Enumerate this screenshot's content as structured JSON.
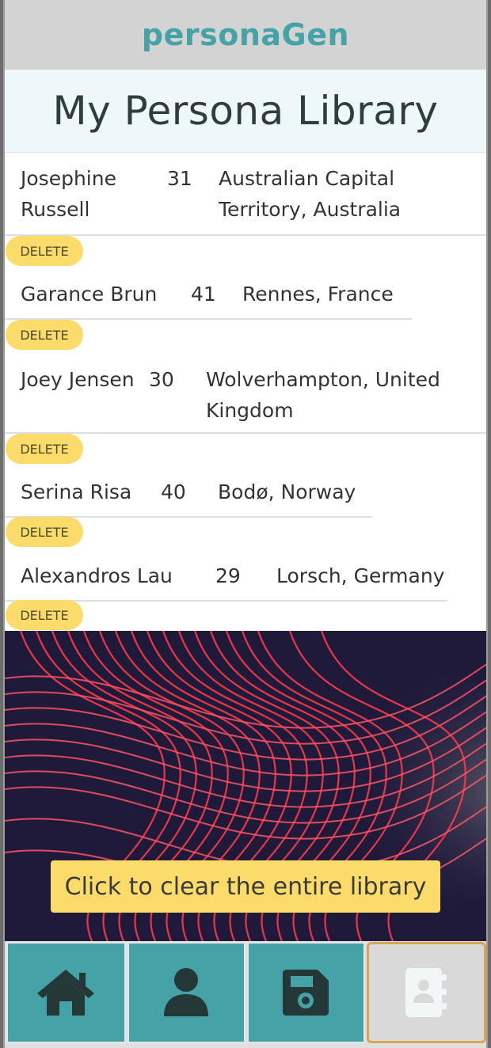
{
  "app": {
    "title": "personaGen"
  },
  "page": {
    "title": "My Persona Library"
  },
  "personas": [
    {
      "name": "Josephine Russell",
      "age": "31",
      "location": "Australian Capital Territory, Australia"
    },
    {
      "name": "Garance Brun",
      "age": "41",
      "location": "Rennes, France"
    },
    {
      "name": "Joey Jensen",
      "age": "30",
      "location": "Wolverhampton, United Kingdom"
    },
    {
      "name": "Serina Risa",
      "age": "40",
      "location": "Bodø, Norway"
    },
    {
      "name": "Alexandros Lau",
      "age": "29",
      "location": "Lorsch, Germany"
    }
  ],
  "delete_label": "DELETE",
  "clear_button_label": "Click to clear the entire library",
  "nav": {
    "items": [
      {
        "icon": "home-icon"
      },
      {
        "icon": "user-icon"
      },
      {
        "icon": "floppy-disk-icon"
      },
      {
        "icon": "address-book-icon",
        "active": true
      }
    ]
  },
  "colors": {
    "header_bg": "#d3d3d3",
    "brand_teal": "#45a2a6",
    "library_header_bg": "#eef8fa",
    "accent_yellow": "#fbdc6a",
    "active_nav_border": "#d9a552",
    "nav_icon": "#253838"
  }
}
